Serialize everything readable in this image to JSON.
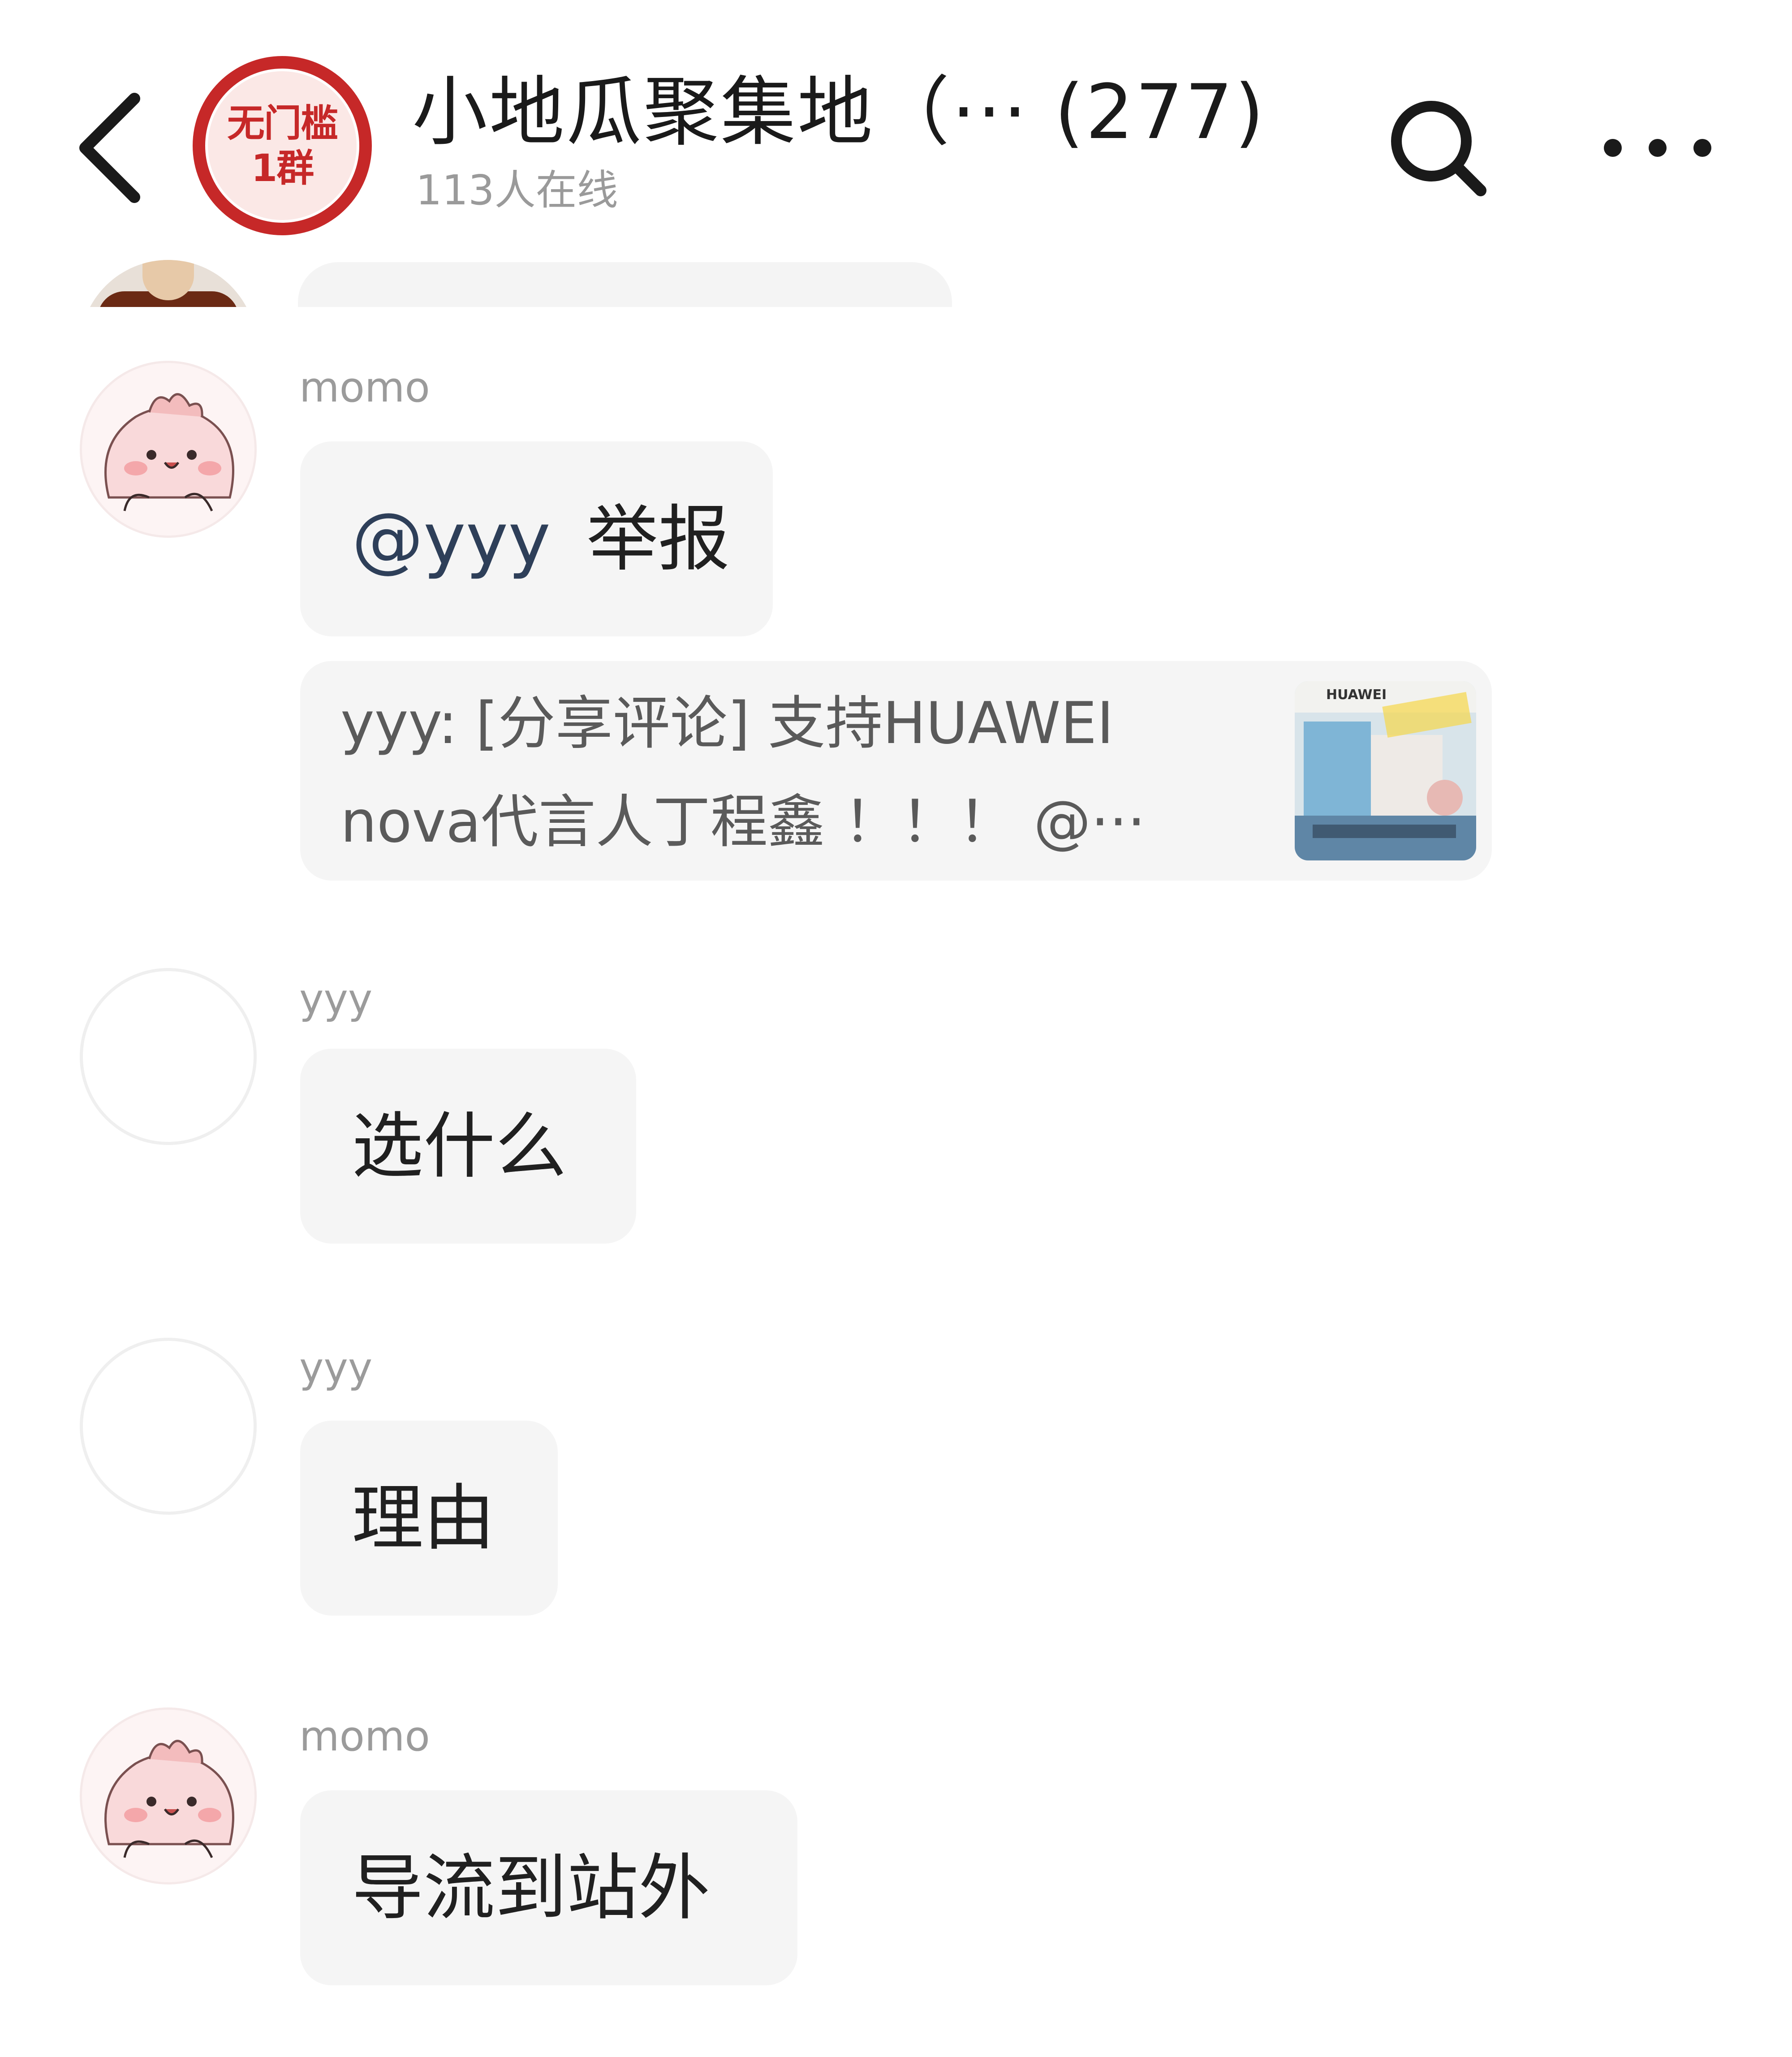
{
  "header": {
    "group_avatar_line1": "无门槛",
    "group_avatar_line2": "1群",
    "title": "小地瓜聚集地（··· (277)",
    "online": "113人在线",
    "back_icon": "chevron-left-icon",
    "search_icon": "search-icon",
    "more_icon": "more-horizontal-icon"
  },
  "messages": [
    {
      "sender": "momo",
      "mention": "@yyy",
      "text": "举报",
      "share": {
        "line1": "yyy: [分享评论] 支持HUAWEI",
        "line2": "nova代言人丁程鑫 ！！！ @···",
        "thumb_label": "HUAWEI"
      }
    },
    {
      "sender": "yyy",
      "text": "选什么"
    },
    {
      "sender": "yyy",
      "text": "理由"
    },
    {
      "sender": "momo",
      "text": "导流到站外"
    }
  ],
  "colors": {
    "bubble_bg": "#f5f5f5",
    "sender_gray": "#9b9b9b",
    "mention_color": "#2e3f59",
    "group_avatar_red": "#c62828"
  }
}
